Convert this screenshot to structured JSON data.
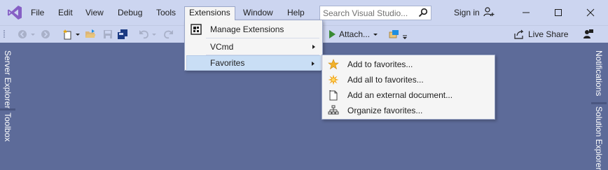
{
  "menubar": {
    "items": [
      "File",
      "Edit",
      "View",
      "Debug",
      "Tools",
      "Extensions",
      "Window",
      "Help"
    ],
    "search_placeholder": "Search Visual Studio...",
    "sign_in": "Sign in"
  },
  "toolbar": {
    "attach_label": "Attach...",
    "live_share": "Live Share"
  },
  "side_tabs": {
    "left": [
      "Server Explorer",
      "Toolbox"
    ],
    "right": [
      "Notifications",
      "Solution Explorer"
    ]
  },
  "extensions_menu": {
    "items": [
      {
        "label": "Manage Extensions",
        "icon": "manage-extensions-icon"
      },
      {
        "label": "VCmd",
        "submenu": true
      },
      {
        "label": "Favorites",
        "submenu": true,
        "highlighted": true
      }
    ]
  },
  "favorites_menu": {
    "items": [
      {
        "label": "Add to favorites...",
        "icon": "star-icon"
      },
      {
        "label": "Add all to favorites...",
        "icon": "star-burst-icon"
      },
      {
        "label": "Add an external document...",
        "icon": "document-icon"
      },
      {
        "label": "Organize favorites...",
        "icon": "hierarchy-icon"
      }
    ]
  },
  "colors": {
    "chrome": "#ccd5f0",
    "background": "#5d6b99",
    "menu_bg": "#f5f5f5",
    "highlight": "#c9def5",
    "vs_purple": "#865fc5"
  }
}
